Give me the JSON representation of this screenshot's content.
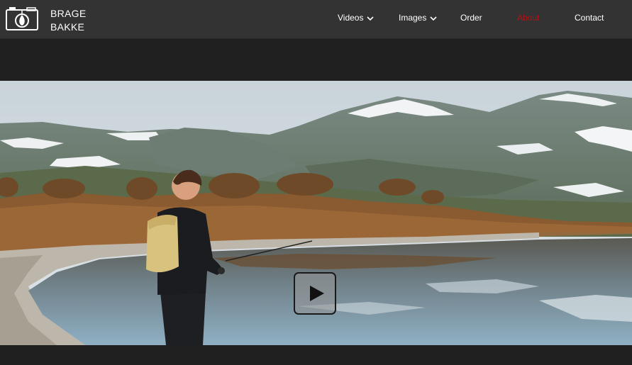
{
  "header": {
    "brand_line1": "BRAGE",
    "brand_line2": "BAKKE",
    "logo_icon": "camera-icon"
  },
  "nav": {
    "items": [
      {
        "label": "Videos",
        "has_dropdown": true
      },
      {
        "label": "Images",
        "has_dropdown": true
      },
      {
        "label": "Order",
        "has_dropdown": false
      },
      {
        "label": "About",
        "has_dropdown": false,
        "active": true
      },
      {
        "label": "Contact",
        "has_dropdown": false
      }
    ]
  },
  "hero": {
    "play_icon": "play-icon"
  },
  "colors": {
    "navbar_bg": "#333333",
    "page_bg": "#202020",
    "active_link": "#b01414",
    "text": "#ffffff"
  }
}
